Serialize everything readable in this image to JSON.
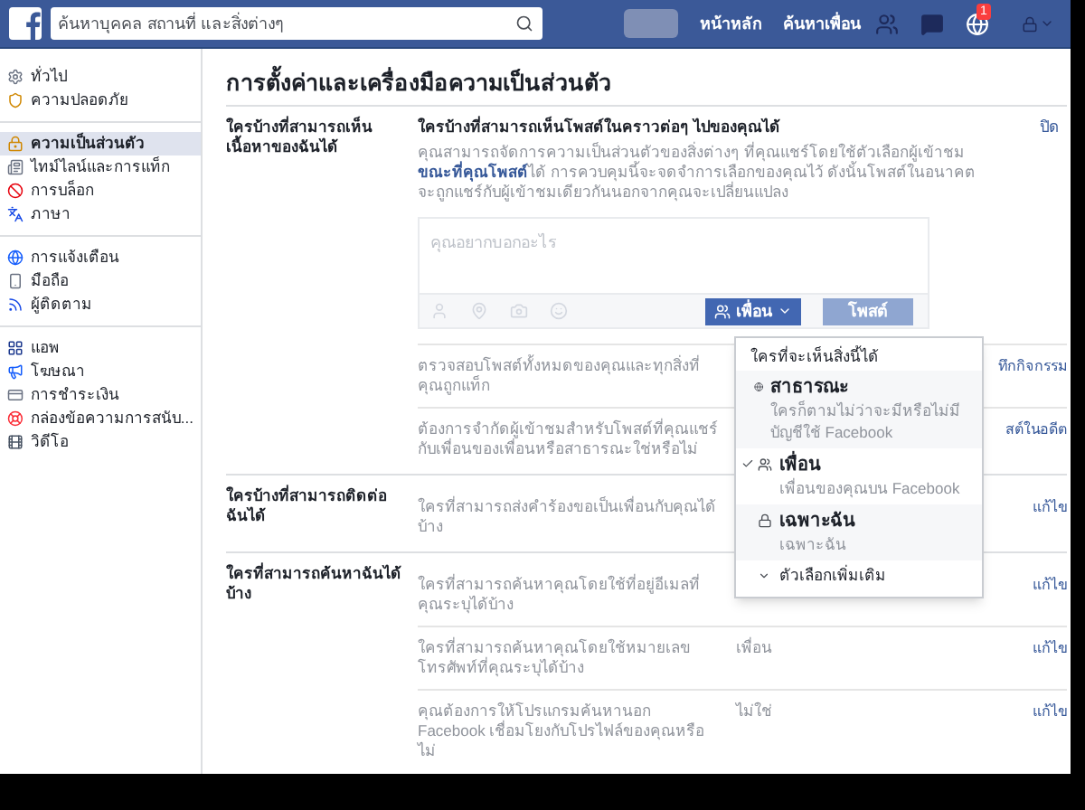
{
  "header": {
    "search_placeholder": "ค้นหาบุคคล สถานที่ และสิ่งต่างๆ",
    "nav": [
      "หน้าหลัก",
      "ค้นหาเพื่อน"
    ],
    "notification_count": "1"
  },
  "sidebar": {
    "groups": [
      [
        {
          "label": "ทั่วไป",
          "selected": false
        },
        {
          "label": "ความปลอดภัย",
          "selected": false
        }
      ],
      [
        {
          "label": "ความเป็นส่วนตัว",
          "selected": true
        },
        {
          "label": "ไทม์ไลน์และการแท็ก",
          "selected": false
        },
        {
          "label": "การบล็อก",
          "selected": false
        },
        {
          "label": "ภาษา",
          "selected": false
        }
      ],
      [
        {
          "label": "การแจ้งเตือน",
          "selected": false
        },
        {
          "label": "มือถือ",
          "selected": false
        },
        {
          "label": "ผู้ติดตาม",
          "selected": false
        }
      ],
      [
        {
          "label": "แอพ",
          "selected": false
        },
        {
          "label": "โฆษณา",
          "selected": false
        },
        {
          "label": "การชำระเงิน",
          "selected": false
        },
        {
          "label": "กล่องข้อความการสนับ...",
          "selected": false
        },
        {
          "label": "วิดีโอ",
          "selected": false
        }
      ]
    ]
  },
  "page_title": "การตั้งค่าและเครื่องมือความเป็นส่วนตัว",
  "sections": [
    {
      "label": "ใครบ้างที่สามารถเห็นเนื้อหาของฉันได้",
      "rows": [
        {
          "kind": "composer",
          "heading": "ใครบ้างที่สามารถเห็นโพสต์ในคราวต่อๆ ไปของคุณได้",
          "description": "คุณสามารถจัดการความเป็นส่วนตัวของสิ่งต่างๆ ที่คุณแชร์โดยใช้ตัวเลือกผู้เข้าชม **ขณะที่คุณโพสต์**ได้ การควบคุมนี้จะจดจำการเลือกของคุณไว้ ดังนั้นโพสต์ในอนาคตจะถูกแชร์กับผู้เข้าชมเดียวกันนอกจากคุณจะเปลี่ยนแปลง",
          "action": "ปิด",
          "placeholder": "คุณอยากบอกอะไร",
          "audience": "เพื่อน",
          "post_button": {
            "label": "โพสต์",
            "disabled": true
          }
        },
        {
          "kind": "setting",
          "description": "ตรวจสอบโพสต์ทั้งหมดของคุณและทุกสิ่งที่คุณถูกแท็ก",
          "action": "ทึกกิจกรรม"
        },
        {
          "kind": "setting",
          "description": "ต้องการจำกัดผู้เข้าชมสำหรับโพสต์ที่คุณแชร์กับเพื่อนของเพื่อนหรือสาธารณะใช่หรือไม่",
          "action": "สต์ในอดีต"
        }
      ]
    },
    {
      "label": "ใครบ้างที่สามารถติดต่อฉันได้",
      "rows": [
        {
          "kind": "setting",
          "description": "ใครที่สามารถส่งคำร้องขอเป็นเพื่อนกับคุณได้บ้าง",
          "action": "แก้ไข"
        }
      ]
    },
    {
      "label": "ใครที่สามารถค้นหาฉันได้บ้าง",
      "rows": [
        {
          "kind": "setting",
          "description": "ใครที่สามารถค้นหาคุณโดยใช้ที่อยู่อีเมลที่คุณระบุได้บ้าง",
          "action": "แก้ไข"
        },
        {
          "kind": "setting",
          "description": "ใครที่สามารถค้นหาคุณโดยใช้หมายเลขโทรศัพท์ที่คุณระบุได้บ้าง",
          "value": "เพื่อน",
          "action": "แก้ไข"
        },
        {
          "kind": "setting",
          "description": "คุณต้องการให้โปรแกรมค้นหานอก Facebook เชื่อมโยงกับโปรไฟล์ของคุณหรือไม่",
          "value": "ไม่ใช่",
          "action": "แก้ไข"
        }
      ]
    }
  ],
  "audience_menu": {
    "title": "ใครที่จะเห็นสิ่งนี้ได้",
    "options": [
      {
        "title": "สาธารณะ",
        "subtitle": "ใครก็ตามไม่ว่าจะมีหรือไม่มีบัญชีใช้ Facebook",
        "selected": false
      },
      {
        "title": "เพื่อน",
        "subtitle": "เพื่อนของคุณบน Facebook",
        "selected": true
      },
      {
        "title": "เฉพาะฉัน",
        "subtitle": "เฉพาะฉัน",
        "selected": false
      }
    ],
    "more": "ตัวเลือกเพิ่มเติม"
  }
}
